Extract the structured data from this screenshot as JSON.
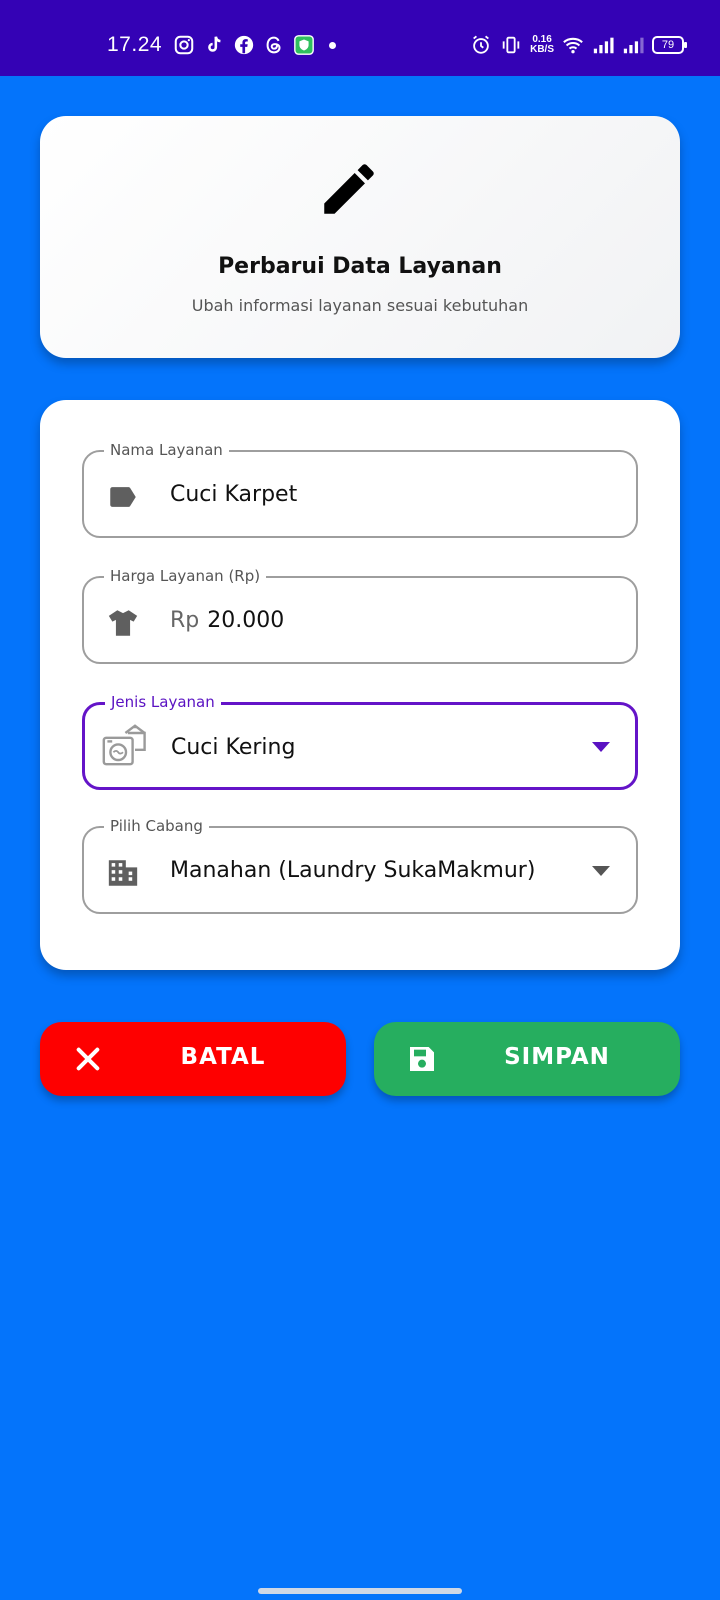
{
  "status_bar": {
    "time": "17.24",
    "net_speed_value": "0.16",
    "net_speed_unit": "KB/S",
    "battery": "79",
    "left_icons": [
      "instagram-icon",
      "tiktok-icon",
      "facebook-icon",
      "threads-icon",
      "shield-app-icon"
    ],
    "right_icons": [
      "alarm-icon",
      "vibrate-icon",
      "wifi-icon",
      "signal-icon",
      "signal-icon"
    ]
  },
  "header": {
    "icon": "pencil-icon",
    "title": "Perbarui Data Layanan",
    "subtitle": "Ubah informasi layanan sesuai kebutuhan"
  },
  "form": {
    "service_name": {
      "label": "Nama Layanan",
      "value": "Cuci Karpet",
      "icon": "tag-icon"
    },
    "price": {
      "label": "Harga Layanan (Rp)",
      "prefix": "Rp",
      "value": "20.000",
      "icon": "shirt-icon"
    },
    "service_type": {
      "label": "Jenis Layanan",
      "value": "Cuci Kering",
      "icon": "laundry-machine-icon"
    },
    "branch": {
      "label": "Pilih Cabang",
      "value": "Manahan (Laundry SukaMakmur)",
      "icon": "building-icon"
    }
  },
  "actions": {
    "cancel_label": "BATAL",
    "save_label": "SIMPAN"
  },
  "colors": {
    "background": "#0474fb",
    "status_bar": "#3402b5",
    "focus": "#6414c8",
    "cancel": "#fe0000",
    "save": "#26ae5f"
  }
}
